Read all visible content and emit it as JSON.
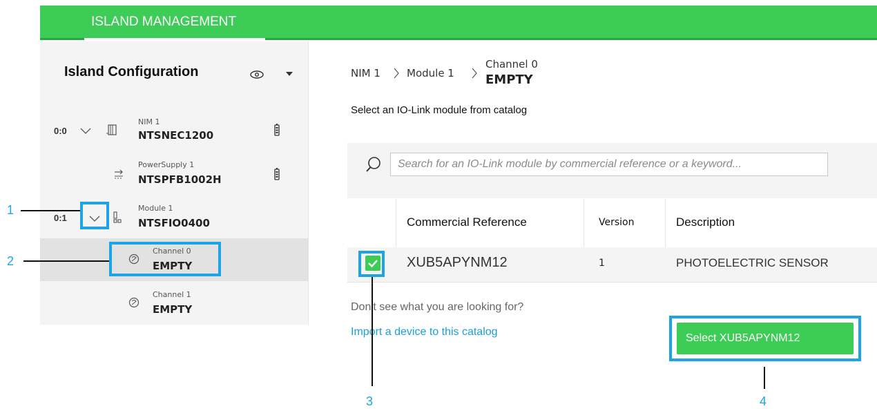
{
  "header": {
    "tab_label": "ISLAND MANAGEMENT"
  },
  "sidebar": {
    "title": "Island Configuration",
    "items": [
      {
        "address": "0:0",
        "sub": "NIM 1",
        "main": "NTSNEC1200",
        "icon": "nim-icon",
        "status_icon": "battery-icon"
      },
      {
        "address": "",
        "sub": "PowerSupply 1",
        "main": "NTSPFB1002H",
        "icon": "power-supply-icon",
        "status_icon": "battery-icon"
      },
      {
        "address": "0:1",
        "sub": "Module 1",
        "main": "NTSFIO0400",
        "icon": "module-icon"
      },
      {
        "address": "",
        "sub": "Channel 0",
        "main": "EMPTY",
        "icon": "channel-icon",
        "selected": true
      },
      {
        "address": "",
        "sub": "Channel 1",
        "main": "EMPTY",
        "icon": "channel-icon"
      }
    ]
  },
  "breadcrumb": {
    "items": [
      "NIM 1",
      "Module 1"
    ],
    "current_sub": "Channel 0",
    "current_title": "EMPTY"
  },
  "main": {
    "instruction": "Select an IO-Link module from catalog",
    "search_placeholder": "Search for an IO-Link module by commercial reference or a keyword...",
    "table": {
      "headers": [
        "Commercial Reference",
        "Version",
        "Description"
      ],
      "rows": [
        {
          "checked": true,
          "reference": "XUB5APYNM12",
          "version": "1",
          "description": "PHOTOELECTRIC SENSOR"
        }
      ]
    },
    "not_found_text": "Don't see what you are looking for?",
    "import_link": "Import a device to this catalog",
    "select_button": "Select XUB5APYNM12"
  },
  "annotations": [
    "1",
    "2",
    "3",
    "4"
  ],
  "colors": {
    "brand_green": "#3dcc56",
    "annotation_blue": "#1ea4e4",
    "link_blue": "#1a9fd8"
  }
}
